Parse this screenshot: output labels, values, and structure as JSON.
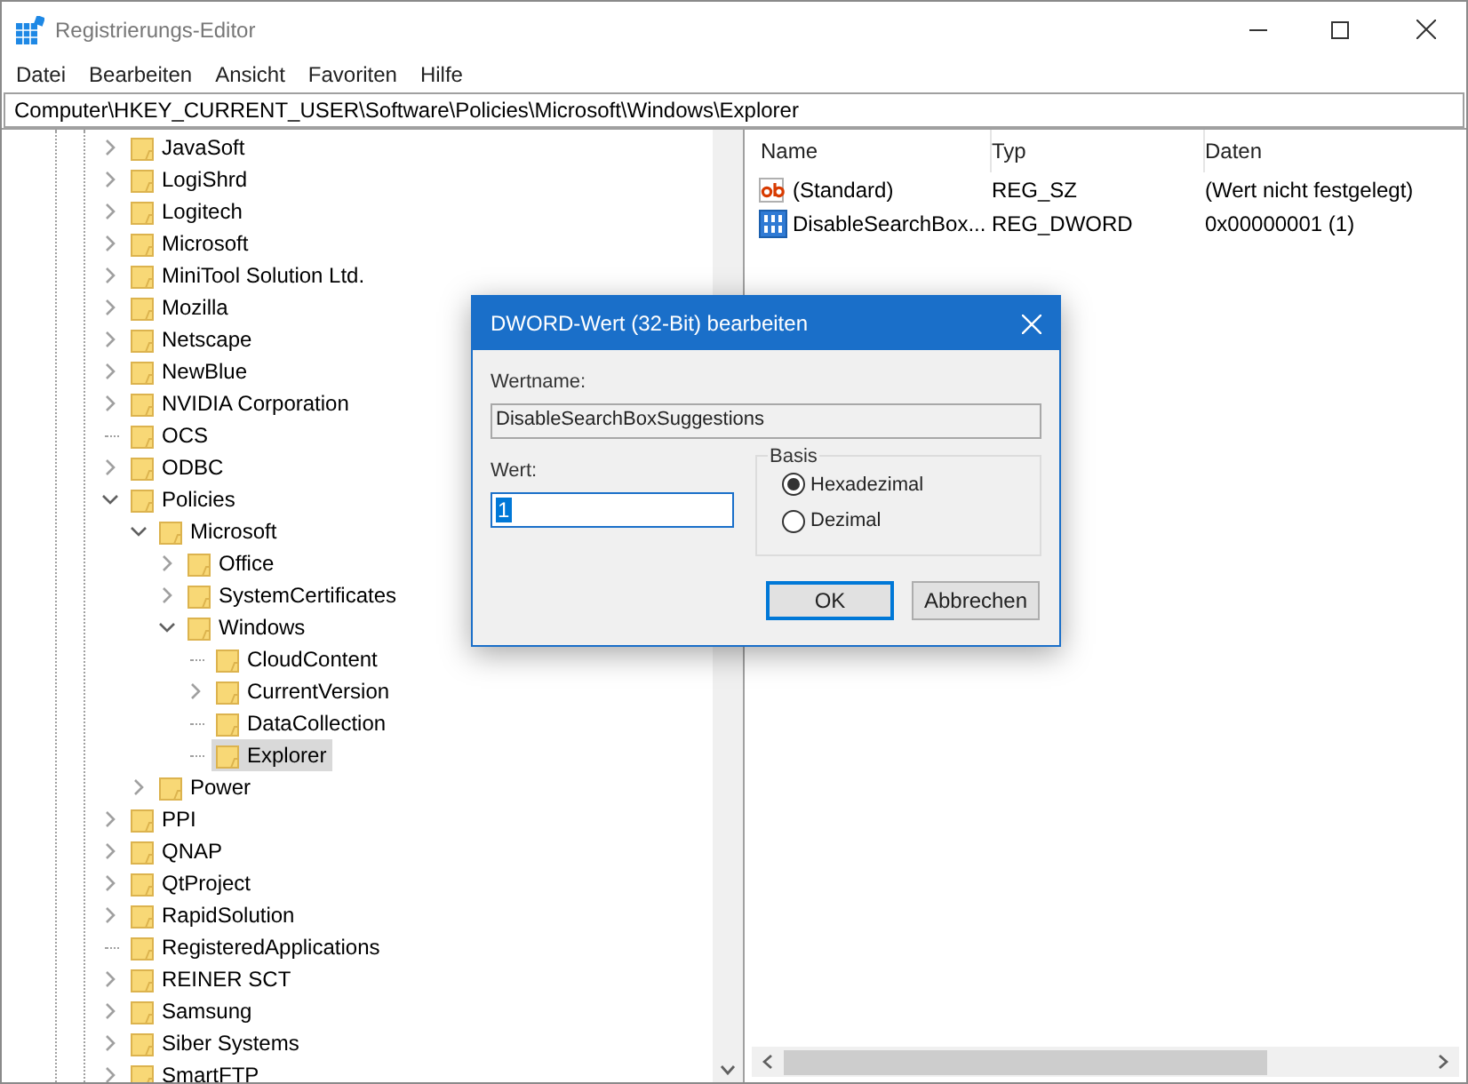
{
  "window": {
    "title": "Registrierungs-Editor"
  },
  "menu": [
    "Datei",
    "Bearbeiten",
    "Ansicht",
    "Favoriten",
    "Hilfe"
  ],
  "address": "Computer\\HKEY_CURRENT_USER\\Software\\Policies\\Microsoft\\Windows\\Explorer",
  "tree": [
    {
      "label": "JavaSoft",
      "kind": "collapsed",
      "selected": false
    },
    {
      "label": "LogiShrd",
      "kind": "collapsed",
      "selected": false
    },
    {
      "label": "Logitech",
      "kind": "collapsed",
      "selected": false
    },
    {
      "label": "Microsoft",
      "kind": "collapsed",
      "selected": false
    },
    {
      "label": "MiniTool Solution Ltd.",
      "kind": "collapsed",
      "selected": false
    },
    {
      "label": "Mozilla",
      "kind": "collapsed",
      "selected": false
    },
    {
      "label": "Netscape",
      "kind": "collapsed",
      "selected": false
    },
    {
      "label": "NewBlue",
      "kind": "collapsed",
      "selected": false
    },
    {
      "label": "NVIDIA Corporation",
      "kind": "collapsed",
      "selected": false
    },
    {
      "label": "OCS",
      "kind": "leaf",
      "selected": false
    },
    {
      "label": "ODBC",
      "kind": "collapsed",
      "selected": false
    },
    {
      "label": "Policies",
      "kind": "expanded",
      "selected": false,
      "children": [
        {
          "label": "Microsoft",
          "kind": "expanded",
          "selected": false,
          "children": [
            {
              "label": "Office",
              "kind": "collapsed",
              "selected": false
            },
            {
              "label": "SystemCertificates",
              "kind": "collapsed",
              "selected": false
            },
            {
              "label": "Windows",
              "kind": "expanded",
              "selected": false,
              "children": [
                {
                  "label": "CloudContent",
                  "kind": "leaf",
                  "selected": false
                },
                {
                  "label": "CurrentVersion",
                  "kind": "collapsed",
                  "selected": false
                },
                {
                  "label": "DataCollection",
                  "kind": "leaf",
                  "selected": false
                },
                {
                  "label": "Explorer",
                  "kind": "leaf",
                  "selected": true
                }
              ]
            }
          ]
        },
        {
          "label": "Power",
          "kind": "collapsed",
          "selected": false
        }
      ]
    },
    {
      "label": "PPI",
      "kind": "collapsed",
      "selected": false
    },
    {
      "label": "QNAP",
      "kind": "collapsed",
      "selected": false
    },
    {
      "label": "QtProject",
      "kind": "collapsed",
      "selected": false
    },
    {
      "label": "RapidSolution",
      "kind": "collapsed",
      "selected": false
    },
    {
      "label": "RegisteredApplications",
      "kind": "leaf",
      "selected": false
    },
    {
      "label": "REINER SCT",
      "kind": "collapsed",
      "selected": false
    },
    {
      "label": "Samsung",
      "kind": "collapsed",
      "selected": false
    },
    {
      "label": "Siber Systems",
      "kind": "collapsed",
      "selected": false
    },
    {
      "label": "SmartFTP",
      "kind": "collapsed",
      "selected": false
    }
  ],
  "values": {
    "columns": [
      "Name",
      "Typ",
      "Daten"
    ],
    "rows": [
      {
        "kind": "string",
        "name": "(Standard)",
        "type": "REG_SZ",
        "data": "(Wert nicht festgelegt)"
      },
      {
        "kind": "dword",
        "name": "DisableSearchBox...",
        "type": "REG_DWORD",
        "data": "0x00000001 (1)"
      }
    ]
  },
  "dialog": {
    "title": "DWORD-Wert (32-Bit) bearbeiten",
    "name_label": "Wertname:",
    "name_value": "DisableSearchBoxSuggestions",
    "value_label": "Wert:",
    "value": "1",
    "base_label": "Basis",
    "bases": [
      {
        "label": "Hexadezimal",
        "selected": true
      },
      {
        "label": "Dezimal",
        "selected": false
      }
    ],
    "buttons": [
      {
        "label": "OK",
        "default": true
      },
      {
        "label": "Abbrechen",
        "default": false
      }
    ]
  }
}
